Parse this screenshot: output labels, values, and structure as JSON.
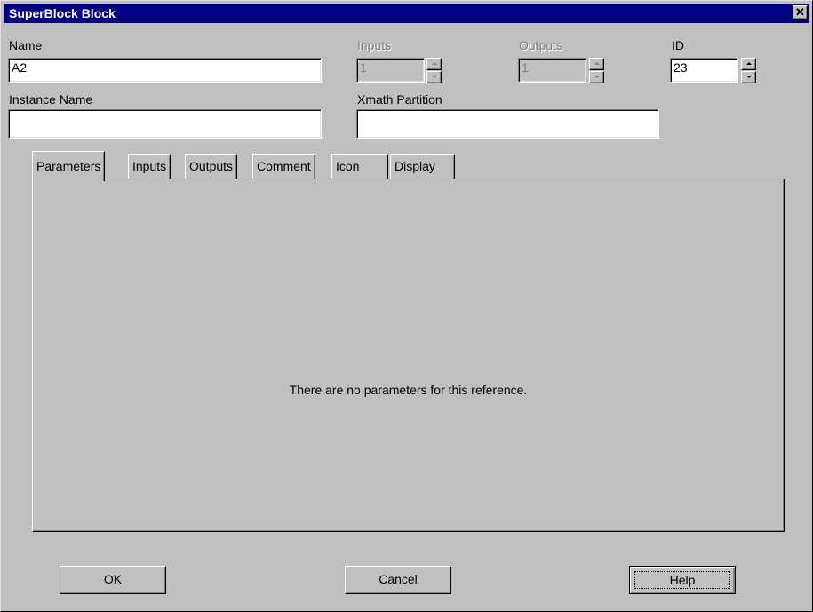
{
  "window": {
    "title": "SuperBlock Block",
    "close_glyph": "✕"
  },
  "fields": {
    "name": {
      "label": "Name",
      "value": "A2"
    },
    "inputs": {
      "label": "Inputs",
      "value": "1"
    },
    "outputs": {
      "label": "Outputs",
      "value": "1"
    },
    "id": {
      "label": "ID",
      "value": "23"
    },
    "instance_name": {
      "label": "Instance Name",
      "value": ""
    },
    "xmath_partition": {
      "label": "Xmath Partition",
      "value": ""
    }
  },
  "tabs": [
    {
      "label": "Parameters",
      "active": true
    },
    {
      "label": "Inputs",
      "active": false
    },
    {
      "label": "Outputs",
      "active": false
    },
    {
      "label": "Comment",
      "active": false
    },
    {
      "label": "Icon",
      "active": false
    },
    {
      "label": "Display",
      "active": false
    }
  ],
  "panel": {
    "message": "There are no parameters for this reference."
  },
  "buttons": {
    "ok": "OK",
    "cancel": "Cancel",
    "help": "Help"
  },
  "colors": {
    "titlebar": "#000080",
    "face": "#c0c0c0"
  }
}
